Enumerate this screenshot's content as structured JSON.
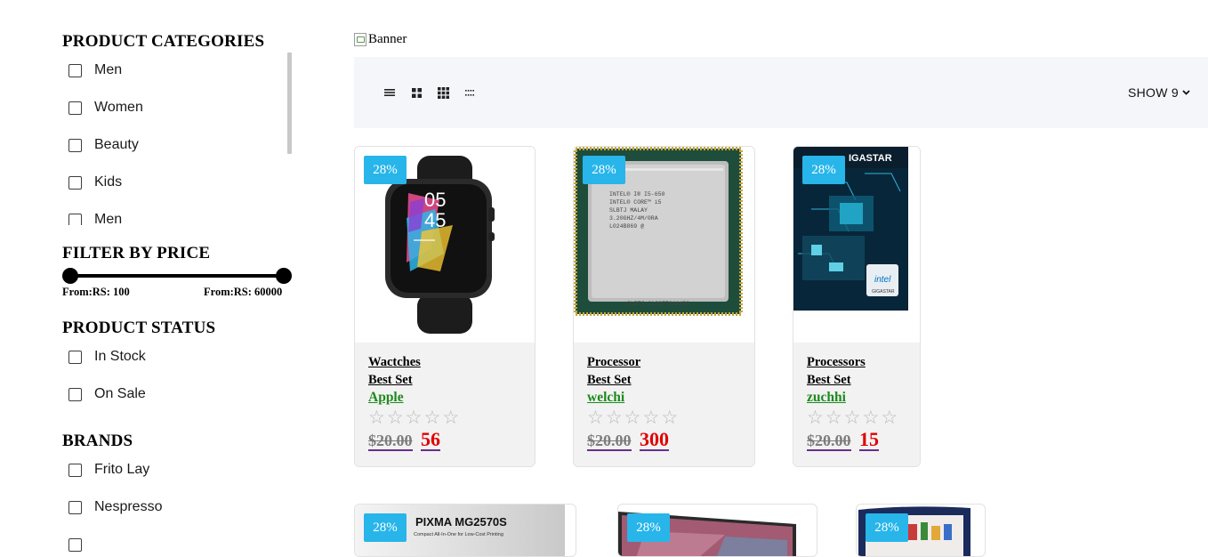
{
  "sidebar": {
    "categories_title": "PRODUCT CATEGORIES",
    "categories": [
      "Men",
      "Women",
      "Beauty",
      "Kids",
      "Men"
    ],
    "price_title": "FILTER BY PRICE",
    "price_from": "From:RS: 100",
    "price_to": "From:RS: 60000",
    "status_title": "PRODUCT STATUS",
    "statuses": [
      "In Stock",
      "On Sale"
    ],
    "brands_title": "BRANDS",
    "brands": [
      "Frito Lay",
      "Nespresso"
    ]
  },
  "main": {
    "banner_alt": "Banner",
    "show_label": "SHOW 9",
    "view_icons": [
      "list-view-icon",
      "grid-2-icon",
      "grid-3-icon",
      "grid-4-icon"
    ]
  },
  "products": [
    {
      "discount": "28%",
      "name": "Wactches",
      "set": "Best Set",
      "brand": "Apple",
      "old_price": "$20.00",
      "price": "56",
      "rating": 0,
      "image": "smartwatch"
    },
    {
      "discount": "28%",
      "name": "Processor",
      "set": "Best Set",
      "brand": "welchi",
      "old_price": "$20.00",
      "price": "300",
      "rating": 0,
      "image": "cpu-chip"
    },
    {
      "discount": "28%",
      "name": "Processors",
      "set": "Best Set",
      "brand": "zuchhi",
      "old_price": "$20.00",
      "price": "15",
      "rating": 0,
      "image": "gigastar-board"
    }
  ],
  "products_row2": [
    {
      "discount": "28%",
      "image": "pixma-printer",
      "image_text": "PIXMA MG2570S",
      "image_subtext": "Compact All-In-One for Low-Cost Printing"
    },
    {
      "discount": "28%",
      "image": "laptop"
    },
    {
      "discount": "28%",
      "image": "mini-fridge"
    }
  ],
  "colors": {
    "badge": "#27b5ea",
    "brand_link": "#1d8a1d",
    "price": "#e00000",
    "toolbar_bg": "#f5f6fa"
  }
}
